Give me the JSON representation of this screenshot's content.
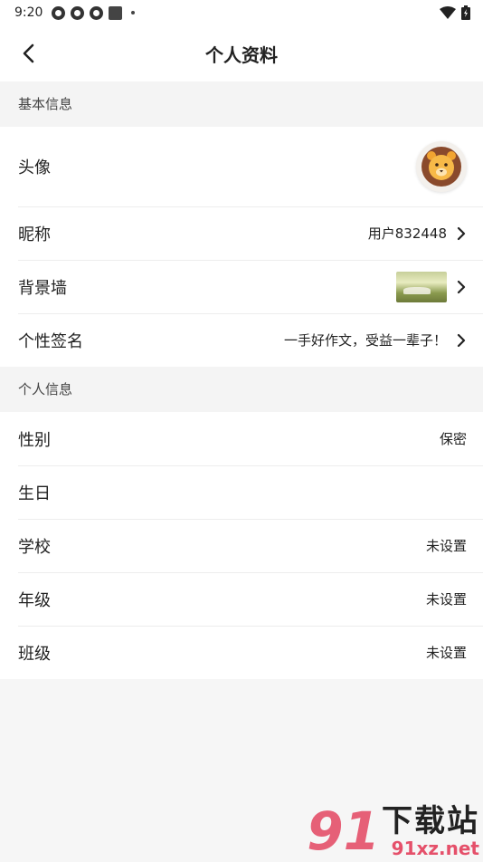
{
  "status_bar": {
    "time": "9:20"
  },
  "header": {
    "title": "个人资料"
  },
  "sections": [
    {
      "title": "基本信息",
      "rows": [
        {
          "label": "头像",
          "value": ""
        },
        {
          "label": "昵称",
          "value": "用户832448"
        },
        {
          "label": "背景墙",
          "value": ""
        },
        {
          "label": "个性签名",
          "value": "一手好作文，受益一辈子！"
        }
      ]
    },
    {
      "title": "个人信息",
      "rows": [
        {
          "label": "性别",
          "value": "保密"
        },
        {
          "label": "生日",
          "value": ""
        },
        {
          "label": "学校",
          "value": "未设置"
        },
        {
          "label": "年级",
          "value": "未设置"
        },
        {
          "label": "班级",
          "value": "未设置"
        }
      ]
    }
  ],
  "watermark": {
    "brand": "下载站",
    "url": "91xz.net",
    "logo": "91"
  },
  "colors": {
    "watermark_accent": "#e5506a",
    "avatar_brown": "#8a4a2c"
  }
}
